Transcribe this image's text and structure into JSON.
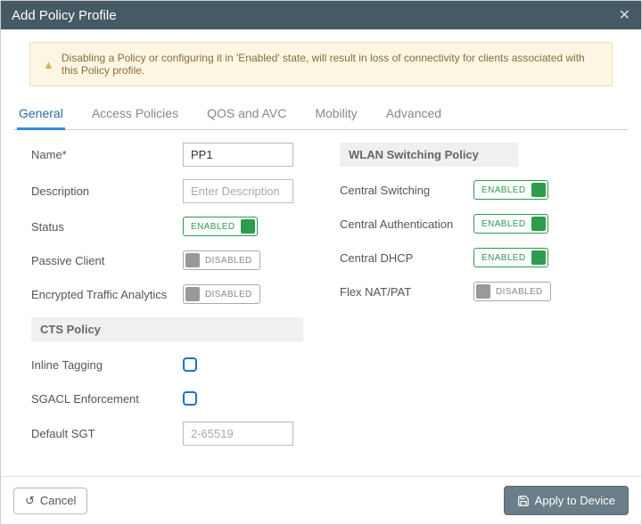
{
  "title": "Add Policy Profile",
  "warning": "Disabling a Policy or configuring it in 'Enabled' state, will result in loss of connectivity for clients associated with this Policy profile.",
  "tabs": {
    "general": "General",
    "access": "Access Policies",
    "qos": "QOS and AVC",
    "mobility": "Mobility",
    "advanced": "Advanced"
  },
  "left": {
    "name_label": "Name*",
    "name_value": "PP1",
    "desc_label": "Description",
    "desc_placeholder": "Enter Description",
    "desc_value": "",
    "status_label": "Status",
    "status_state": "ENABLED",
    "passive_label": "Passive Client",
    "passive_state": "DISABLED",
    "eta_label": "Encrypted Traffic Analytics",
    "eta_state": "DISABLED",
    "cts_header": "CTS Policy",
    "inline_label": "Inline Tagging",
    "sgacl_label": "SGACL Enforcement",
    "sgt_label": "Default SGT",
    "sgt_placeholder": "2-65519",
    "sgt_value": ""
  },
  "right": {
    "header": "WLAN Switching Policy",
    "csw_label": "Central Switching",
    "csw_state": "ENABLED",
    "cauth_label": "Central Authentication",
    "cauth_state": "ENABLED",
    "cdhcp_label": "Central DHCP",
    "cdhcp_state": "ENABLED",
    "flex_label": "Flex NAT/PAT",
    "flex_state": "DISABLED"
  },
  "footer": {
    "cancel": "Cancel",
    "apply": "Apply to Device"
  }
}
